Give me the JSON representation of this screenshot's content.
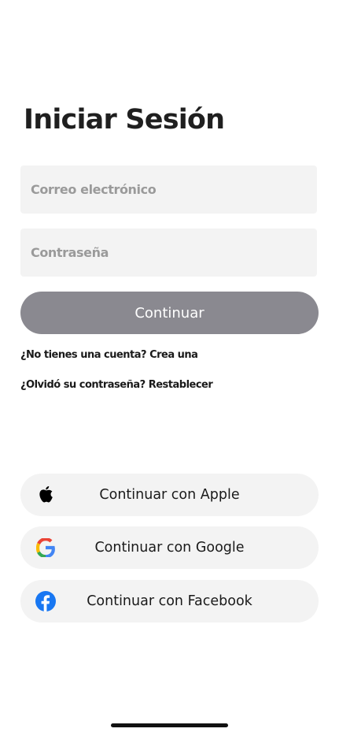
{
  "login": {
    "title": "Iniciar Sesión",
    "email_placeholder": "Correo electrónico",
    "password_placeholder": "Contraseña",
    "continue_label": "Continuar"
  },
  "links": {
    "signup_prompt": "¿No tienes una cuenta?",
    "signup_action": "Crea una",
    "reset_prompt": "¿Olvidó su contraseña?",
    "reset_action": "Restablecer"
  },
  "social": {
    "apple_label": "Continuar con Apple",
    "google_label": "Continuar con Google",
    "facebook_label": "Continuar con Facebook"
  },
  "icons": {
    "apple": "apple-icon",
    "google": "google-icon",
    "facebook": "facebook-icon"
  },
  "colors": {
    "continue_button": "#8a8990",
    "field_background": "#f3f3f3",
    "facebook_blue": "#1877f2"
  }
}
